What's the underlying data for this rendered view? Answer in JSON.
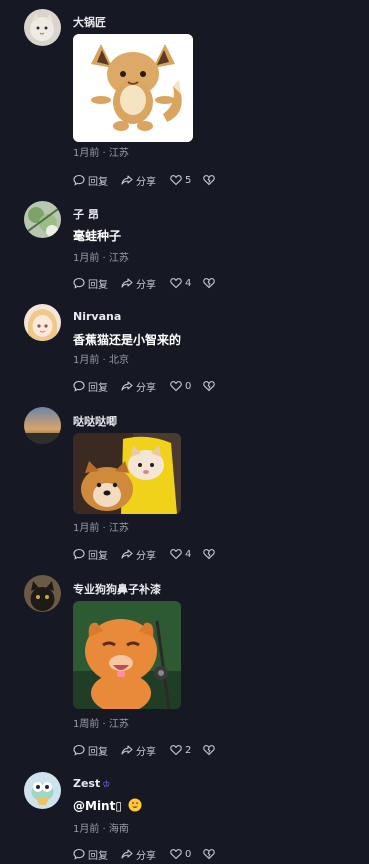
{
  "labels": {
    "reply": "回复",
    "share": "分享"
  },
  "comments": [
    {
      "username": "大锅匠",
      "text": "",
      "meta": "1月前 · 江苏",
      "likes": "5"
    },
    {
      "username": "子 昂",
      "text": "毫蛙种子",
      "meta": "1月前 · 江苏",
      "likes": "4"
    },
    {
      "username": "Nirvana",
      "text": "香蕉猫还是小智来的",
      "meta": "1月前 · 北京",
      "likes": "0"
    },
    {
      "username": "哒哒哒唧",
      "text": "",
      "meta": "1月前 · 江苏",
      "likes": "4"
    },
    {
      "username": "专业狗狗鼻子补漆",
      "text": "",
      "meta": "1周前 · 江苏",
      "likes": "2"
    },
    {
      "username": "Zest",
      "text": "@Mint▯",
      "meta": "1月前 · 海南",
      "likes": "0"
    }
  ]
}
